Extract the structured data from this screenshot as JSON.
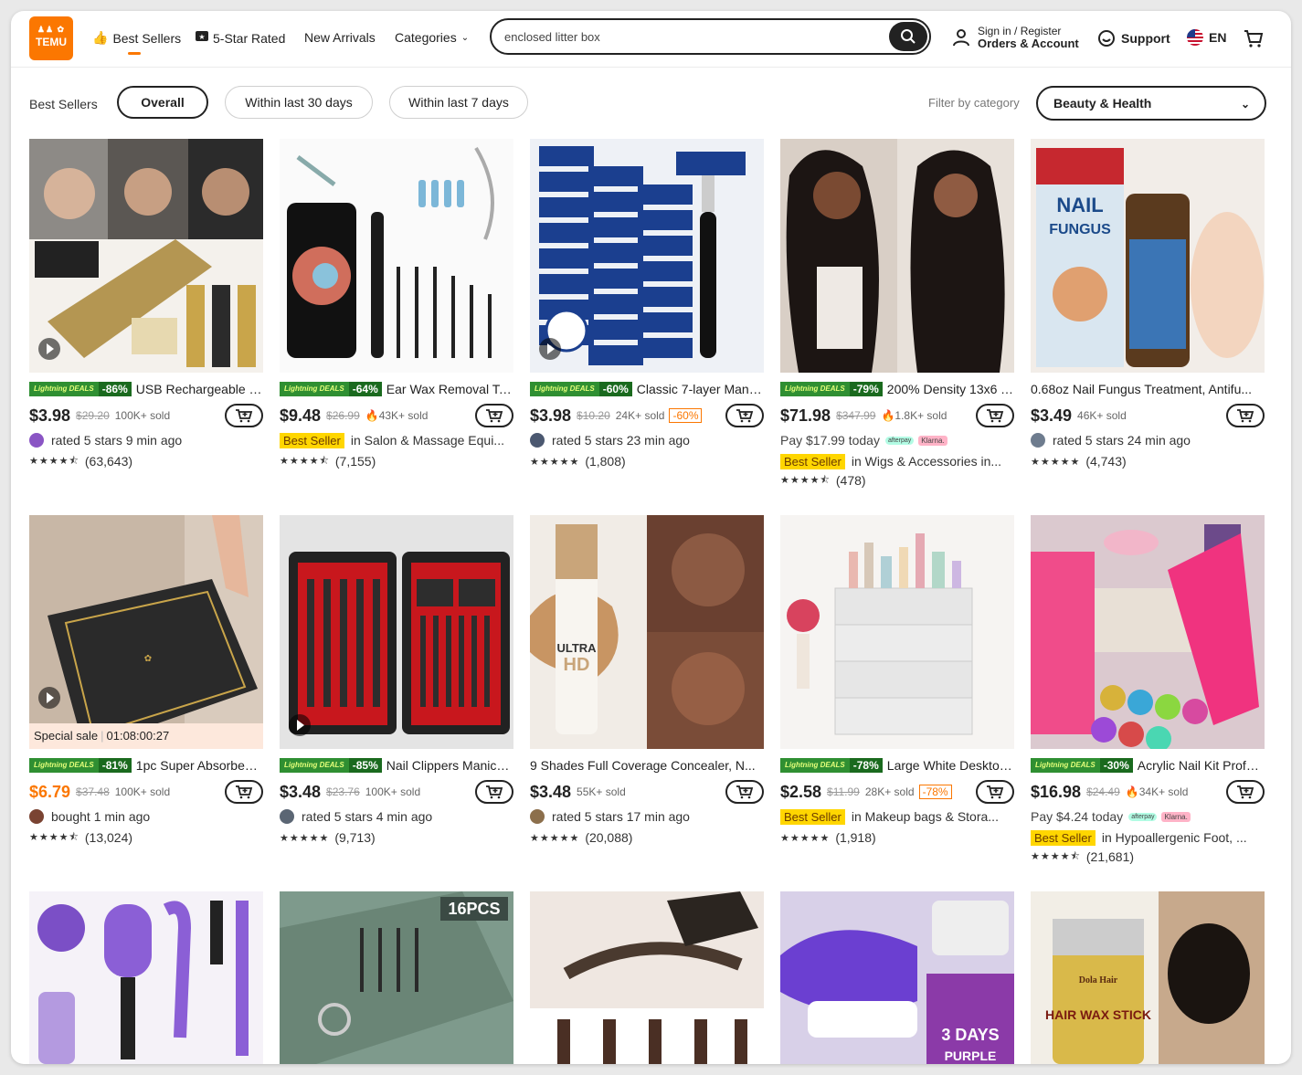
{
  "header": {
    "logo_top": "♟♟ ✿",
    "logo_text": "TEMU",
    "nav": [
      {
        "label": "Best Sellers",
        "icon": "thumbs-up-icon"
      },
      {
        "label": "5-Star Rated",
        "icon": "star-badge-icon"
      },
      {
        "label": "New Arrivals"
      },
      {
        "label": "Categories",
        "icon": "chevron-down-icon"
      }
    ],
    "search_value": "enclosed litter box",
    "account_line1": "Sign in / Register",
    "account_line2": "Orders & Account",
    "support": "Support",
    "lang": "EN"
  },
  "filters": {
    "label": "Best Sellers",
    "tabs": [
      "Overall",
      "Within last 30 days",
      "Within last 7 days"
    ],
    "active_tab": "Overall",
    "category_label": "Filter by category",
    "category_value": "Beauty & Health"
  },
  "colors": {
    "brand": "#fb7701",
    "deal_green": "#1a6a1e",
    "best_seller_yellow": "#ffd600"
  },
  "products": [
    {
      "title": "USB Rechargeable Hai...",
      "deal": "-86%",
      "price": "$3.98",
      "orig": "$29.20",
      "sold": "100K+ sold",
      "l3": "rated 5 stars 9 min ago",
      "rating": "(63,643)",
      "stars": "★★★★⯪"
    },
    {
      "title": "Ear Wax Removal Tool ...",
      "deal": "-64%",
      "price": "$9.48",
      "orig": "$26.99",
      "sold": "43K+ sold",
      "best": "Best Seller",
      "bestcat": "in Salon & Massage Equi...",
      "rating": "(7,155)",
      "stars": "★★★★⯪"
    },
    {
      "title": "Classic 7-layer Manual...",
      "deal": "-60%",
      "price": "$3.98",
      "orig": "$10.20",
      "sold": "24K+ sold",
      "disc": "-60%",
      "l3": "rated 5 stars 23 min ago",
      "rating": "(1,808)",
      "stars": "★★★★★"
    },
    {
      "title": "200% Density 13x6 Tr...",
      "deal": "-79%",
      "price": "$71.98",
      "orig": "$347.99",
      "sold": "1.8K+ sold",
      "pay": "Pay $17.99 today",
      "afterpay": "afterpay",
      "klarna": "Klarna.",
      "best": "Best Seller",
      "bestcat": "in Wigs & Accessories in...",
      "rating": "(478)",
      "stars": "★★★★⯪"
    },
    {
      "title": "0.68oz Nail Fungus Treatment, Antifu...",
      "price": "$3.49",
      "sold": "46K+ sold",
      "l3": "rated 5 stars 24 min ago",
      "rating": "(4,743)",
      "stars": "★★★★★"
    },
    {
      "title": "1pc Super Absorbent F...",
      "deal": "-81%",
      "price": "$6.79",
      "orig": "$37.48",
      "sold": "100K+ sold",
      "special_label": "Special sale",
      "special_timer": "01:08:00:27",
      "l3": "bought 1 min ago",
      "rating": "(13,024)",
      "stars": "★★★★⯪"
    },
    {
      "title": "Nail Clippers Manicure ...",
      "deal": "-85%",
      "price": "$3.48",
      "orig": "$23.76",
      "sold": "100K+ sold",
      "l3": "rated 5 stars 4 min ago",
      "rating": "(9,713)",
      "stars": "★★★★★"
    },
    {
      "title": "9 Shades Full Coverage Concealer, N...",
      "price": "$3.48",
      "sold": "55K+ sold",
      "l3": "rated 5 stars 17 min ago",
      "rating": "(20,088)",
      "stars": "★★★★★"
    },
    {
      "title": "Large White Desktop ...",
      "deal": "-78%",
      "price": "$2.58",
      "orig": "$11.99",
      "sold": "28K+ sold",
      "disc": "-78%",
      "best": "Best Seller",
      "bestcat": "in Makeup bags & Stora...",
      "rating": "(1,918)",
      "stars": "★★★★★"
    },
    {
      "title": "Acrylic Nail Kit Professi...",
      "deal": "-30%",
      "price": "$16.98",
      "orig": "$24.49",
      "sold": "34K+ sold",
      "pay": "Pay $4.24 today",
      "afterpay": "afterpay",
      "klarna": "Klarna.",
      "best": "Best Seller",
      "bestcat": "in Hypoallergenic Foot, ...",
      "rating": "(21,681)",
      "stars": "★★★★⯪"
    }
  ],
  "deal_label": "Lightning DEALS",
  "row3_images": [
    "16PCS",
    "3 DAYS",
    "PURPLE",
    "HAIR WAX STICK",
    "Dola Hair"
  ]
}
